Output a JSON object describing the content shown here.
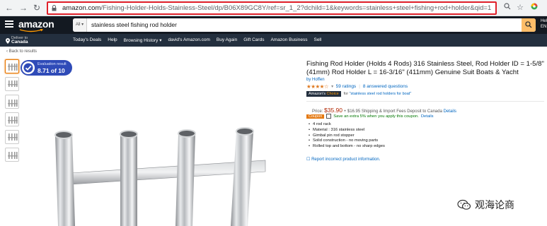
{
  "browser": {
    "url_host": "amazon.com",
    "url_path": "/Fishing-Holder-Holds-Stainless-Steel/dp/B06X89GC8Y/ref=sr_1_2?dchild=1&keywords=stainless+steel+fishing+rod+holder&qid=1582909854&sr=...",
    "icons": [
      "back-arrow-icon",
      "forward-arrow-icon",
      "reload-icon",
      "lock-icon",
      "search-icon",
      "star-icon",
      "extension-icon"
    ]
  },
  "header": {
    "logo": "amazon",
    "search_category": "All ▾",
    "search_query": "stainless steel fishing rod holder",
    "deliver_label": "Deliver to",
    "deliver_location": "Canada",
    "edge_text": "Hel EN",
    "nav": [
      "Today's Deals",
      "Help",
      "Browsing History ▾",
      "david's Amazon.com",
      "Buy Again",
      "Gift Cards",
      "Amazon Business",
      "Sell"
    ]
  },
  "page": {
    "back_link": "‹ Back to results",
    "evaluation": {
      "label": "Evaluation result",
      "value": "8.71 of 10"
    },
    "product": {
      "title": "Fishing Rod Holder (Holds 4 Rods) 316 Stainless Steel, Rod Holder ID = 1-5/8\" (41mm) Rod Holder L = 16-3/16\" (411mm) Genuine Suit Boats & Yacht",
      "brand": "by Hoffen",
      "stars": "★★★★☆",
      "rating_count": "59 ratings",
      "answered": "8 answered questions",
      "choice_badge_prefix": "Amazon's",
      "choice_badge_suffix": "Choice",
      "choice_for_prefix": "for",
      "choice_for_query": "\"stainless steel rod holders for boat\"",
      "price_label": "Price:",
      "price": "$35.90",
      "shipping": "+ $16.95 Shipping & Import Fees Deposit to Canada",
      "shipping_link": "Details",
      "coupon_badge": "Coupon",
      "coupon_text": "Save an extra 5% when you apply this coupon.",
      "coupon_link": "Details",
      "bullets": [
        "4 rod rack",
        "Material : 316 stainless steel",
        "Gimbal pin rod stopper",
        "Solid construction - no moving parts",
        "Rolled top and bottom - no sharp edges"
      ],
      "report_link": "Report incorrect product information."
    },
    "watermark": "观海论商"
  },
  "colors": {
    "highlight_border": "#e0202a",
    "amazon_dark": "#131921",
    "amazon_nav": "#232f3e",
    "search_button": "#febd69",
    "evaluation_badge": "#2f4bb8",
    "price": "#b12704",
    "link": "#0066c0"
  }
}
